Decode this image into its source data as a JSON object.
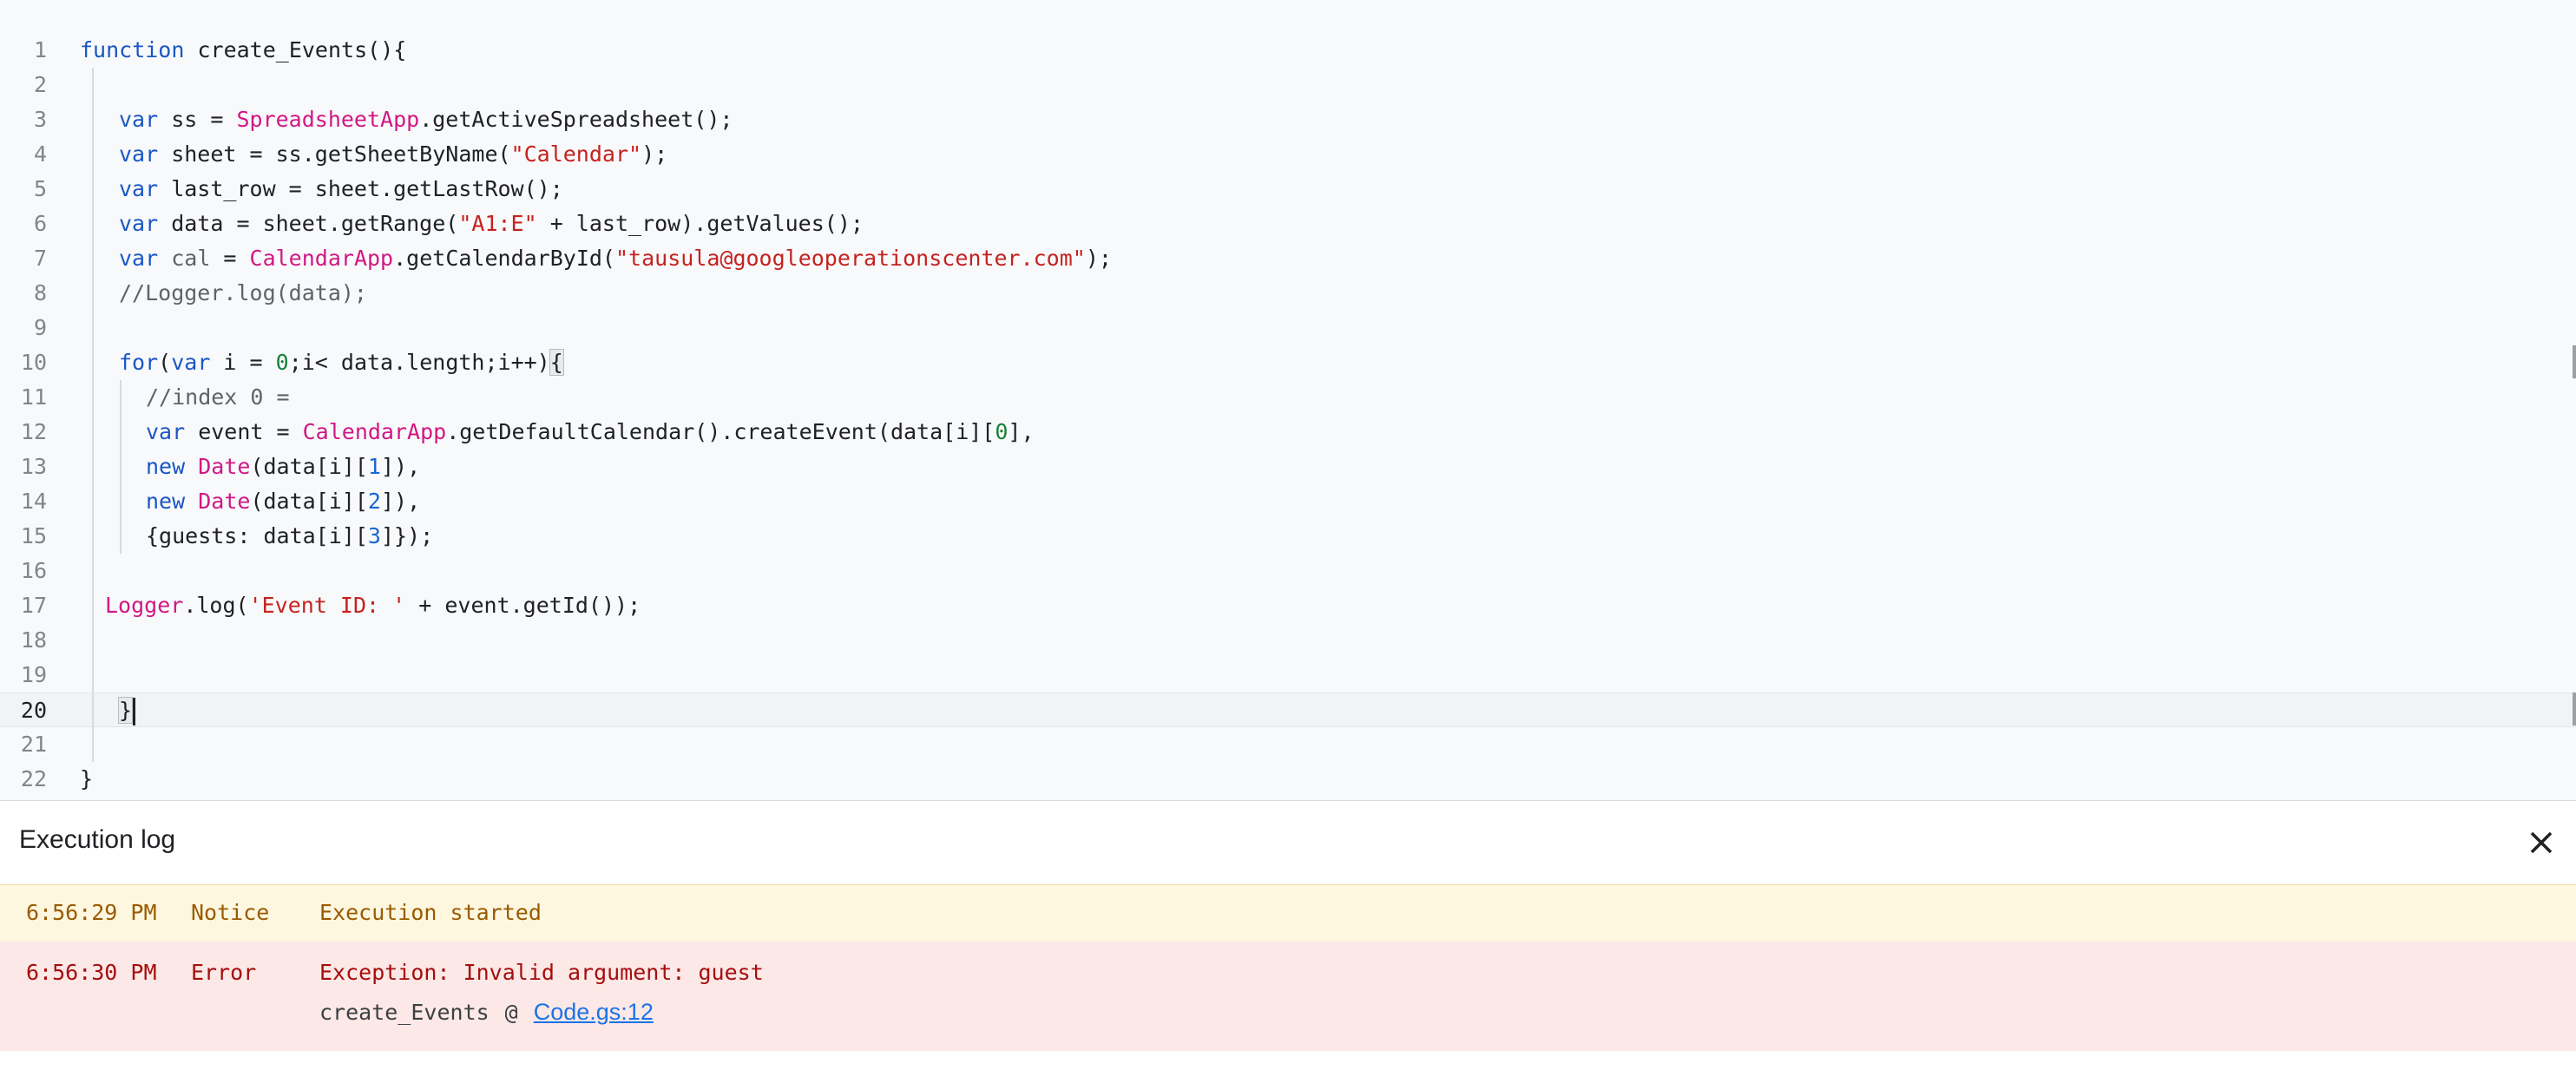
{
  "editor": {
    "line_numbers": [
      "1",
      "2",
      "3",
      "4",
      "5",
      "6",
      "7",
      "8",
      "9",
      "10",
      "11",
      "12",
      "13",
      "14",
      "15",
      "16",
      "17",
      "18",
      "19",
      "20",
      "21",
      "22"
    ],
    "current_line": "20"
  },
  "log": {
    "title": "Execution log",
    "close_icon": "close-icon",
    "entries": [
      {
        "time": "6:56:29 PM",
        "severity": "Notice",
        "message": "Execution started",
        "color": "#fef7e0"
      },
      {
        "time": "6:56:30 PM",
        "severity": "Error",
        "message": "Exception: Invalid argument: guest",
        "color": "#fce8e6",
        "trace": {
          "function": "create_Events",
          "at": "@",
          "location": "Code.gs:12"
        }
      }
    ]
  },
  "colors": {
    "keyword": "#1a57c4",
    "class": "#d01884",
    "string": "#c5221f",
    "number": "#188038",
    "link": "#1a73e8"
  }
}
